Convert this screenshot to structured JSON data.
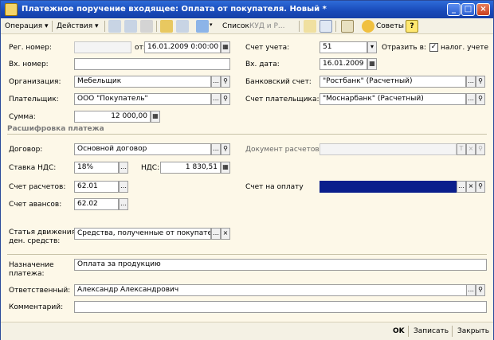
{
  "window": {
    "title": "Платежное поручение входящее: Оплата от покупателя. Новый *"
  },
  "toolbar": {
    "operation": "Операция",
    "actions": "Действия",
    "list": "Список",
    "kudir": "КУД и Р...",
    "tips": "Советы",
    "help": "?"
  },
  "form": {
    "reg_number_label": "Рег. номер:",
    "reg_number": "",
    "from_label": "от:",
    "date": "16.01.2009  0:00:00",
    "in_number_label": "Вх. номер:",
    "in_number": "",
    "org_label": "Организация:",
    "org": "Мебельщик",
    "payer_label": "Плательщик:",
    "payer": "ООО \"Покупатель\"",
    "sum_label": "Сумма:",
    "sum": "12 000,00",
    "account_label": "Счет учета:",
    "account": "51",
    "reflect_label": "Отразить в:",
    "tax_label": "налог. учете",
    "in_date_label": "Вх. дата:",
    "in_date": "16.01.2009",
    "bank_label": "Банковский счет:",
    "bank": "\"Ростбанк\" (Расчетный)",
    "payer_account_label": "Счет плательщика:",
    "payer_account": "\"Моснарбанк\" (Расчетный)"
  },
  "details": {
    "section_title": "Расшифровка платежа",
    "contract_label": "Договор:",
    "contract": "Основной договор",
    "settle_doc_label": "Документ расчетов:",
    "settle_doc": "",
    "vat_rate_label": "Ставка НДС:",
    "vat_rate": "18%",
    "vat_label": "НДС:",
    "vat": "1 830,51",
    "settle_acc_label": "Счет расчетов:",
    "settle_acc": "62.01",
    "invoice_label": "Счет на оплату",
    "invoice": "",
    "advance_acc_label": "Счет авансов:",
    "advance_acc": "62.02",
    "cashflow_label_1": "Статья движения",
    "cashflow_label_2": "ден. средств:",
    "cashflow": "Средства, полученные от покупателей"
  },
  "bottom": {
    "purpose_label_1": "Назначение",
    "purpose_label_2": "платежа:",
    "purpose": "Оплата за продукцию",
    "responsible_label": "Ответственный:",
    "responsible": "Александр Александрович",
    "comment_label": "Комментарий:",
    "comment": ""
  },
  "footer": {
    "ok": "OK",
    "save": "Записать",
    "close": "Закрыть"
  },
  "colors": {
    "title": "#1849b8",
    "background": "#fdf8e8",
    "selected": "#0a1e8c"
  }
}
